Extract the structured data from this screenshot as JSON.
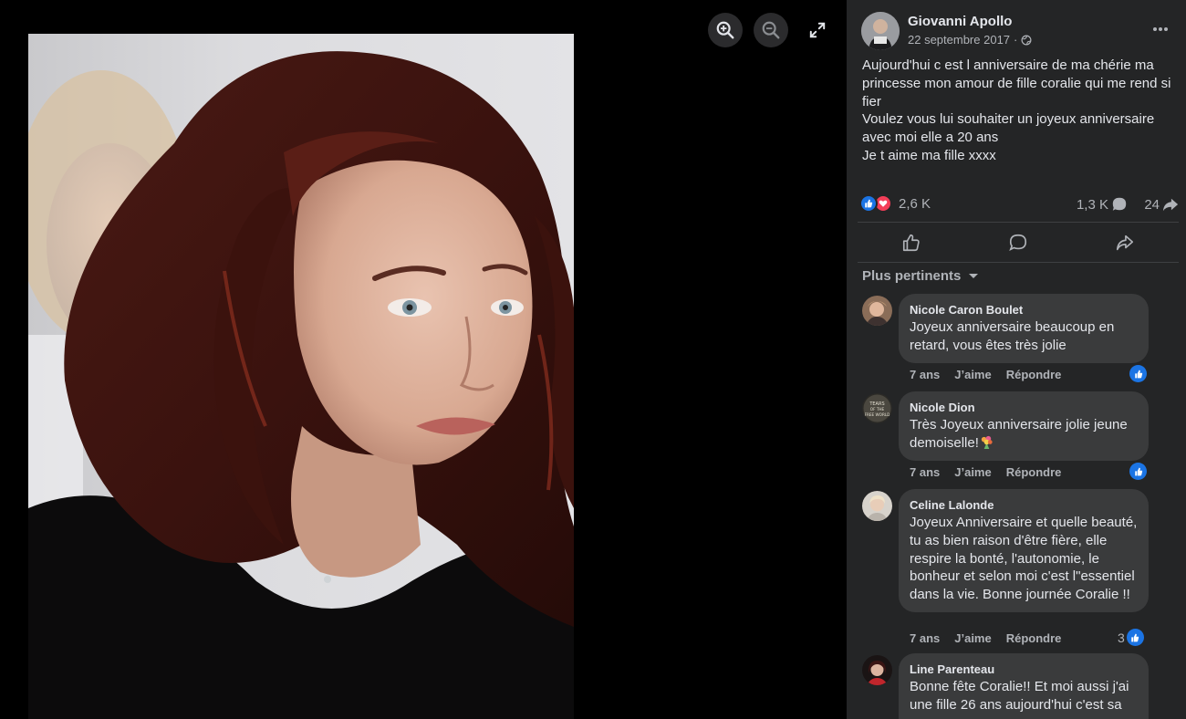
{
  "viewer": {
    "zoom_in_icon": "zoom-in-icon",
    "zoom_out_icon": "zoom-out-icon",
    "fullscreen_icon": "fullscreen-icon"
  },
  "post": {
    "author": "Giovanni Apollo",
    "date": "22 septembre 2017",
    "separator": "·",
    "privacy_icon": "globe-icon",
    "text_lines": [
      "Aujourd'hui c est l anniversaire de ma chérie ma princesse mon amour de fille coralie qui me rend si fier",
      "Voulez vous lui souhaiter un joyeux anniversaire avec moi elle a 20 ans",
      "Je t aime ma fille xxxx"
    ],
    "reactions_count": "2,6 K",
    "comments_count": "1,3 K",
    "shares_count": "24"
  },
  "sort": {
    "label": "Plus pertinents"
  },
  "comments": [
    {
      "name": "Nicole Caron Boulet",
      "text": "Joyeux anniversaire beaucoup en retard, vous êtes très jolie",
      "age": "7 ans",
      "like_label": "J’aime",
      "reply_label": "Répondre",
      "likes": ""
    },
    {
      "name": "Nicole Dion",
      "text": "Très Joyeux anniversaire jolie jeune demoiselle!",
      "avatar_text": "TEARS OF THE FREE WORLD",
      "age": "7 ans",
      "like_label": "J’aime",
      "reply_label": "Répondre",
      "likes": ""
    },
    {
      "name": "Celine Lalonde",
      "text": "Joyeux Anniversaire et quelle beauté, tu as bien raison d'être fière, elle respire la bonté, l'autonomie, le bonheur et selon moi c'est l\"essentiel dans la vie. Bonne journée Coralie !!",
      "age": "7 ans",
      "like_label": "J’aime",
      "reply_label": "Répondre",
      "likes": "3"
    },
    {
      "name": "Line Parenteau",
      "text": "Bonne fête Coralie!! Et moi aussi j'ai une fille 26 ans aujourd'hui c'est sa"
    }
  ],
  "colors": {
    "panel_bg": "#242526",
    "bubble_bg": "#3a3b3c",
    "like_blue": "#1b74e4",
    "love_red": "#f33e58",
    "text_primary": "#e4e6eb",
    "text_secondary": "#b0b3b8"
  }
}
